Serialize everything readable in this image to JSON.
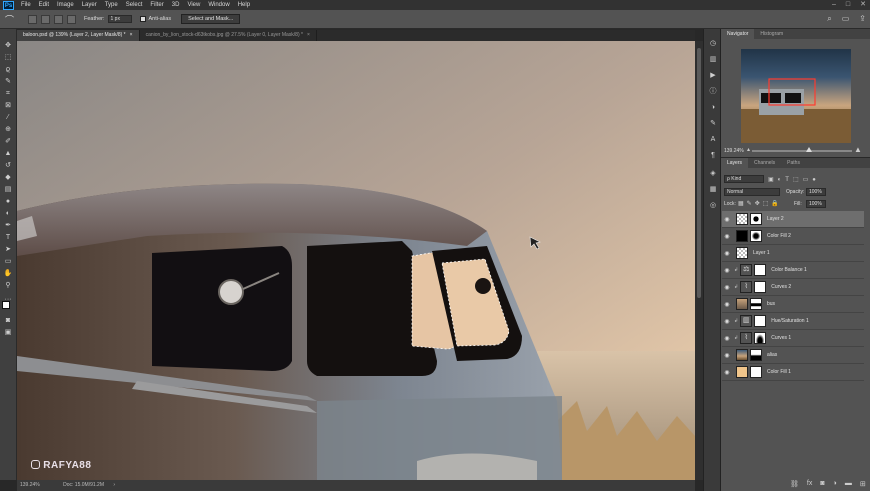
{
  "app": {
    "logo": "Ps",
    "menu": [
      "File",
      "Edit",
      "Image",
      "Layer",
      "Type",
      "Select",
      "Filter",
      "3D",
      "View",
      "Window",
      "Help"
    ],
    "window_controls": [
      "–",
      "□",
      "✕"
    ]
  },
  "options": {
    "feather_label": "Feather:",
    "feather_value": "1 px",
    "antialias_label": "Anti-alias",
    "select_mask_label": "Select and Mask..."
  },
  "tabs": [
    {
      "label": "baloon.psd @ 139% (Layer 2, Layer Mask/8) *",
      "close": "×"
    },
    {
      "label": "canion_by_lion_stock-d63tkobs.jpg @ 27.5% (Layer 0, Layer Mask/8) *",
      "close": "×"
    }
  ],
  "status": {
    "zoom": "139.24%",
    "doc": "Doc: 15.0M/91.2M",
    "arrow": "›"
  },
  "watermark": "RAFYA88",
  "navigator": {
    "tabs": [
      "Navigator",
      "Histogram"
    ],
    "zoom": "139.24%"
  },
  "layers_panel": {
    "tabs": [
      "Layers",
      "Channels",
      "Paths"
    ],
    "kind": "ρ Kind",
    "blend": "Normal",
    "opacity_label": "Opacity:",
    "opacity": "100%",
    "lock_label": "Lock:",
    "fill_label": "Fill:",
    "fill": "100%",
    "layers": [
      {
        "name": "Layer 2",
        "selected": true
      },
      {
        "name": "Color Fill 2",
        "selected": false
      },
      {
        "name": "Layer 1",
        "selected": false
      },
      {
        "name": "Color Balance 1",
        "selected": false
      },
      {
        "name": "Curves 2",
        "selected": false
      },
      {
        "name": "bus",
        "selected": false
      },
      {
        "name": "Hue/Saturation 1",
        "selected": false
      },
      {
        "name": "Curves 1",
        "selected": false
      },
      {
        "name": "alias",
        "selected": false
      },
      {
        "name": "Color Fill 1",
        "selected": false
      }
    ],
    "footer_icons": [
      "link-icon",
      "fx-icon",
      "mask-icon",
      "adjustment-icon",
      "folder-icon",
      "new-layer-icon",
      "trash-icon"
    ]
  },
  "colors": {
    "accent": "#31a8ff",
    "panel": "#535353",
    "canvas_bg": "#282828"
  }
}
